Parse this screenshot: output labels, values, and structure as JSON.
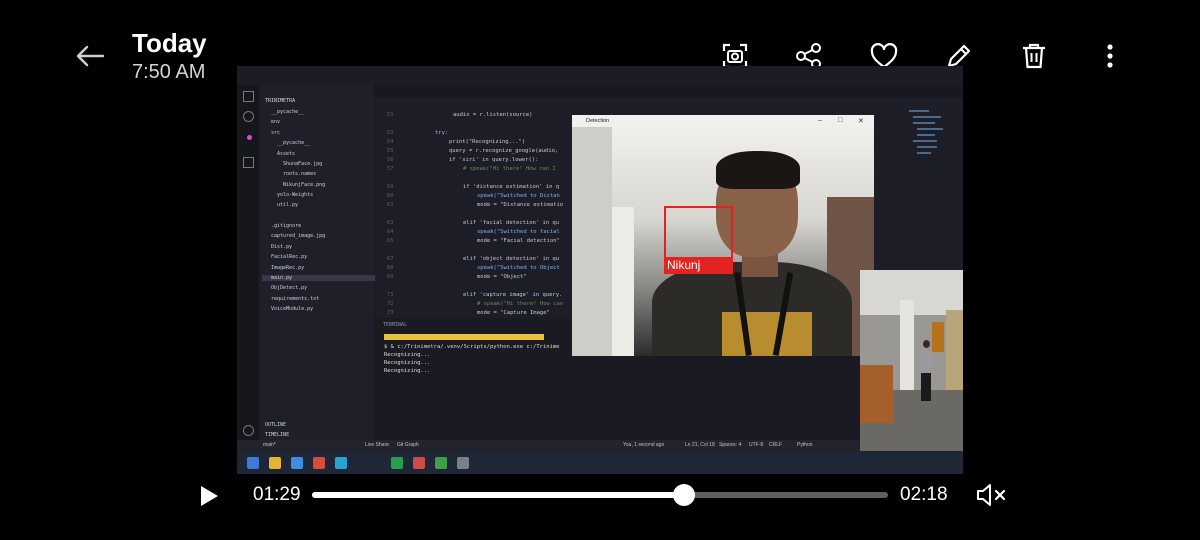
{
  "header": {
    "title": "Today",
    "time": "7:50 AM"
  },
  "toolbar": {
    "back_icon": "arrow-left-icon",
    "actions": [
      "screenshot-icon",
      "share-icon",
      "favorite-icon",
      "edit-icon",
      "delete-icon",
      "more-icon"
    ]
  },
  "video": {
    "explorer": {
      "header": "TRINIMETRA",
      "items": [
        "__pycache__",
        "env",
        "src",
        "__pycache__",
        "Assets",
        "ShunaFace.jpg",
        "roots.names",
        "NikunjFace.png",
        "yolo-Weights",
        "util.py",
        ".gitignore",
        "captured_image.jpg",
        "Dist.py",
        "FacialRec.py",
        "ImageRec.py",
        "main.py",
        "ObjDetect.py",
        "requirements.txt",
        "VoiceModule.py"
      ],
      "footer_outline": "OUTLINE",
      "footer_timeline": "TIMELINE"
    },
    "code": [
      {
        "ln": "51",
        "text": "audio = r.listen(source)"
      },
      {
        "ln": "53",
        "text": "try:"
      },
      {
        "ln": "54",
        "text": "print(\"Recognizing...\")"
      },
      {
        "ln": "55",
        "text": "query = r.recognize_google(audio,"
      },
      {
        "ln": "56",
        "text": "if 'siri' in query.lower():"
      },
      {
        "ln": "57",
        "text": "# speak(\"Hi there! How can I"
      },
      {
        "ln": "59",
        "text": "if 'distance estimation' in q"
      },
      {
        "ln": "60",
        "text": "speak(\"Switched to Distan"
      },
      {
        "ln": "61",
        "text": "mode = \"Distance estimatio"
      },
      {
        "ln": "63",
        "text": "elif 'facial detection' in qu"
      },
      {
        "ln": "64",
        "text": "speak(\"Switched to facial"
      },
      {
        "ln": "65",
        "text": "mode = \"Facial detection\""
      },
      {
        "ln": "67",
        "text": "elif 'object detection' in qu"
      },
      {
        "ln": "68",
        "text": "speak(\"Switched to Object"
      },
      {
        "ln": "69",
        "text": "mode = \"Object\""
      },
      {
        "ln": "71",
        "text": "elif 'capture image' in query."
      },
      {
        "ln": "72",
        "text": "# speak(\"Hi there! How can"
      },
      {
        "ln": "73",
        "text": "mode = \"Capture Image\""
      }
    ],
    "terminal": {
      "tabs": "TERMINAL",
      "lines": [
        "$ & c:/Trinimetra/.venv/Scripts/python.exe c:/Trinime",
        "Recognizing...",
        "Recognizing...",
        "Recognizing..."
      ]
    },
    "status_bar": {
      "left": "main*",
      "live_share": "Live Share",
      "git_graph": "Git Graph",
      "position": "Ln 21, Col 18",
      "spaces": "Spaces: 4",
      "encoding": "UTF-8",
      "eol": "CRLF",
      "language": "Python",
      "you": "You, 1 second ago"
    },
    "detection_window": {
      "title": "Detection",
      "face_label": "Nikunj"
    }
  },
  "playback": {
    "current_time": "01:29",
    "duration": "02:18",
    "progress_fraction": 0.645,
    "muted": true
  }
}
